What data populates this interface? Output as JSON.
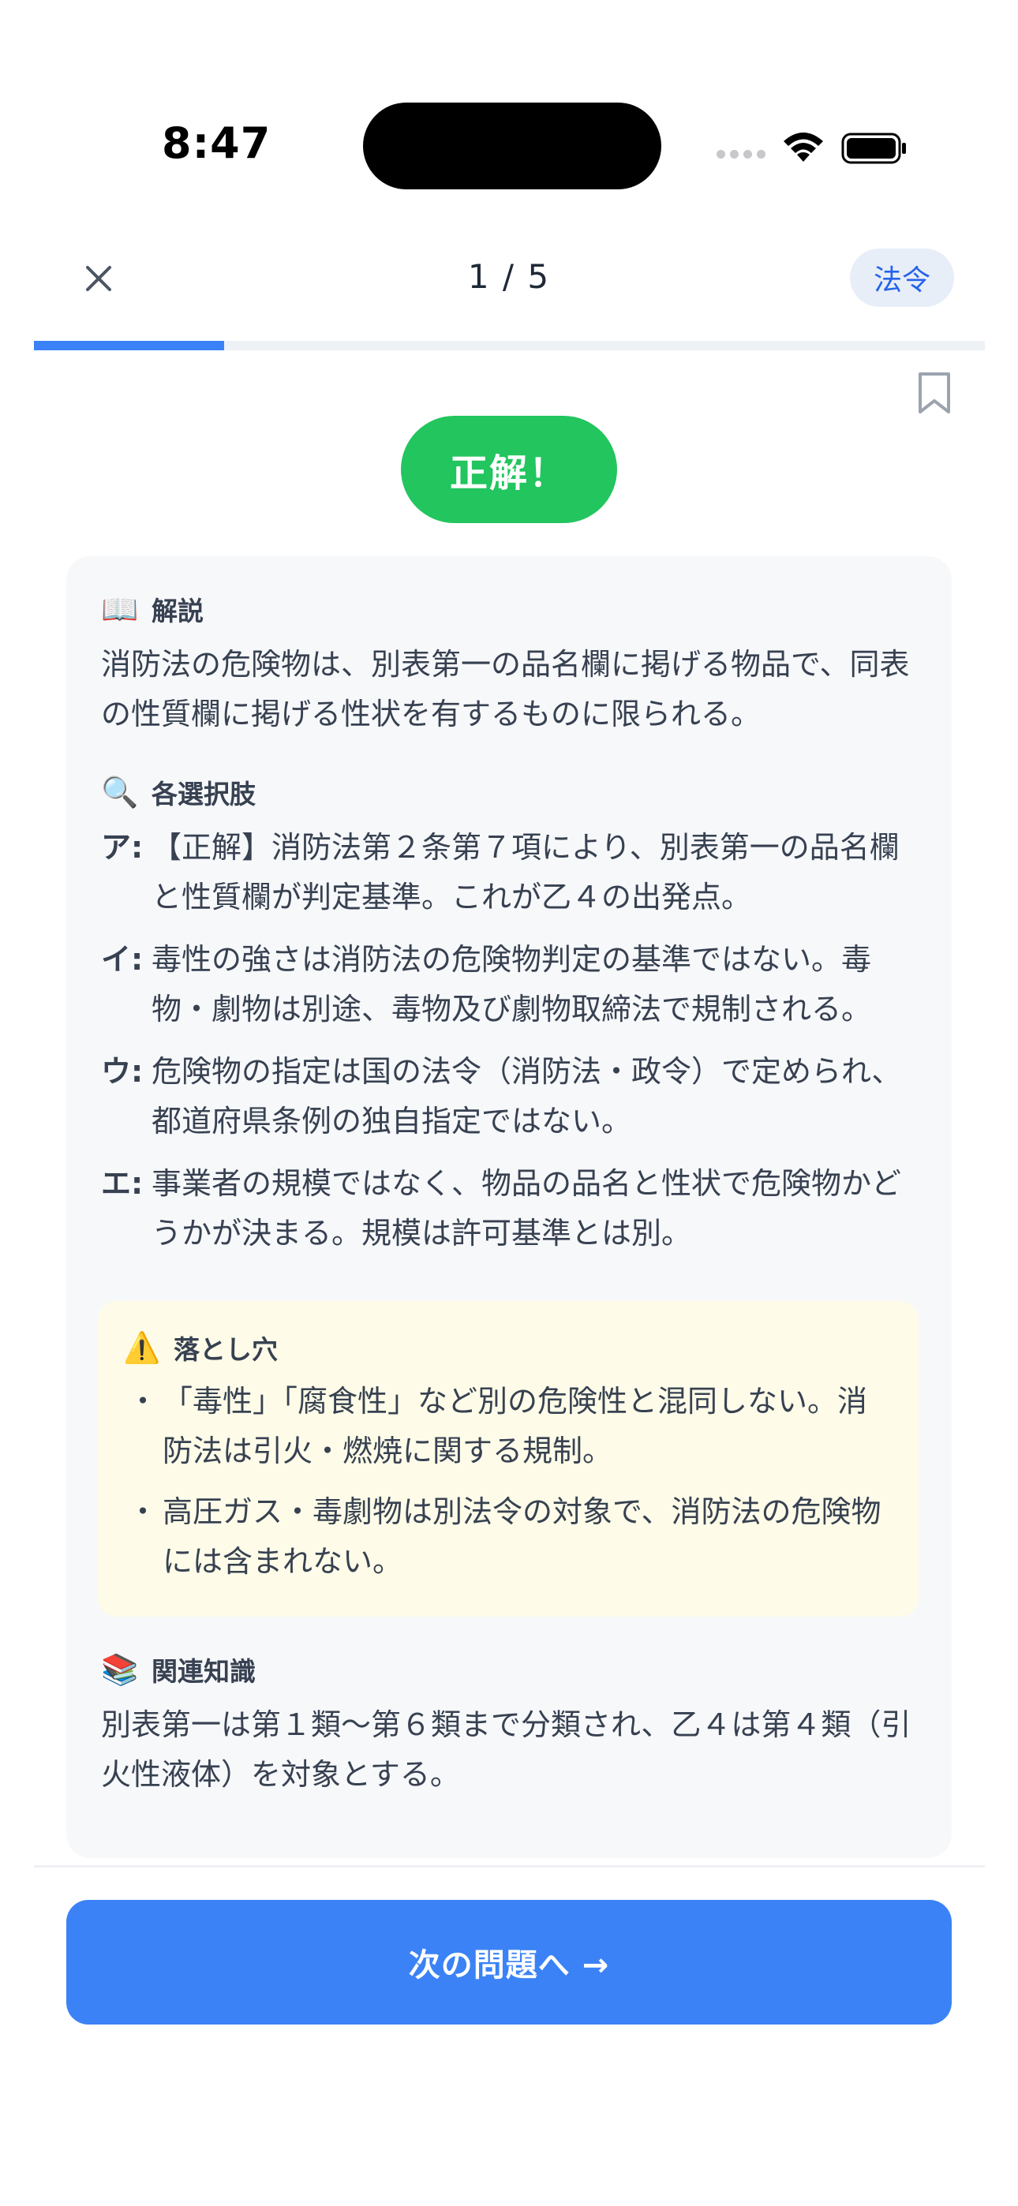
{
  "status_bar": {
    "time": "8:47"
  },
  "header": {
    "close_icon": "close-icon",
    "progress_text": "1 / 5",
    "progress_fraction": 0.2,
    "category_label": "法令",
    "bookmark_icon": "bookmark-icon"
  },
  "result": {
    "label": "正解！",
    "color": "#22c55e"
  },
  "explanation": {
    "title": "解説",
    "icon": "book-icon",
    "text": "消防法の危険物は、別表第一の品名欄に掲げる物品で、同表の性質欄に掲げる性状を有するものに限られる。"
  },
  "choices": {
    "title": "各選択肢",
    "icon": "magnifier-icon",
    "items": [
      {
        "key": "ア:",
        "text": "【正解】消防法第２条第７項により、別表第一の品名欄と性質欄が判定基準。これが乙４の出発点。"
      },
      {
        "key": "イ:",
        "text": "毒性の強さは消防法の危険物判定の基準ではない。毒物・劇物は別途、毒物及び劇物取締法で規制される。"
      },
      {
        "key": "ウ:",
        "text": "危険物の指定は国の法令（消防法・政令）で定められ、都道府県条例の独自指定ではない。"
      },
      {
        "key": "エ:",
        "text": "事業者の規模ではなく、物品の品名と性状で危険物かどうかが決まる。規模は許可基準とは別。"
      }
    ]
  },
  "pitfall": {
    "title": "落とし穴",
    "icon": "warning-icon",
    "bullets": [
      "「毒性」「腐食性」など別の危険性と混同しない。消防法は引火・燃焼に関する規制。",
      "高圧ガス・毒劇物は別法令の対象で、消防法の危険物には含まれない。"
    ]
  },
  "related": {
    "title": "関連知識",
    "icon": "books-icon",
    "text": "別表第一は第１類〜第６類まで分類され、乙４は第４類（引火性液体）を対象とする。"
  },
  "footer": {
    "next_label": "次の問題へ →"
  },
  "colors": {
    "accent": "#3b82f6",
    "success": "#22c55e",
    "badge_bg": "#e8eef8",
    "pitfall_bg": "#fefce8"
  }
}
